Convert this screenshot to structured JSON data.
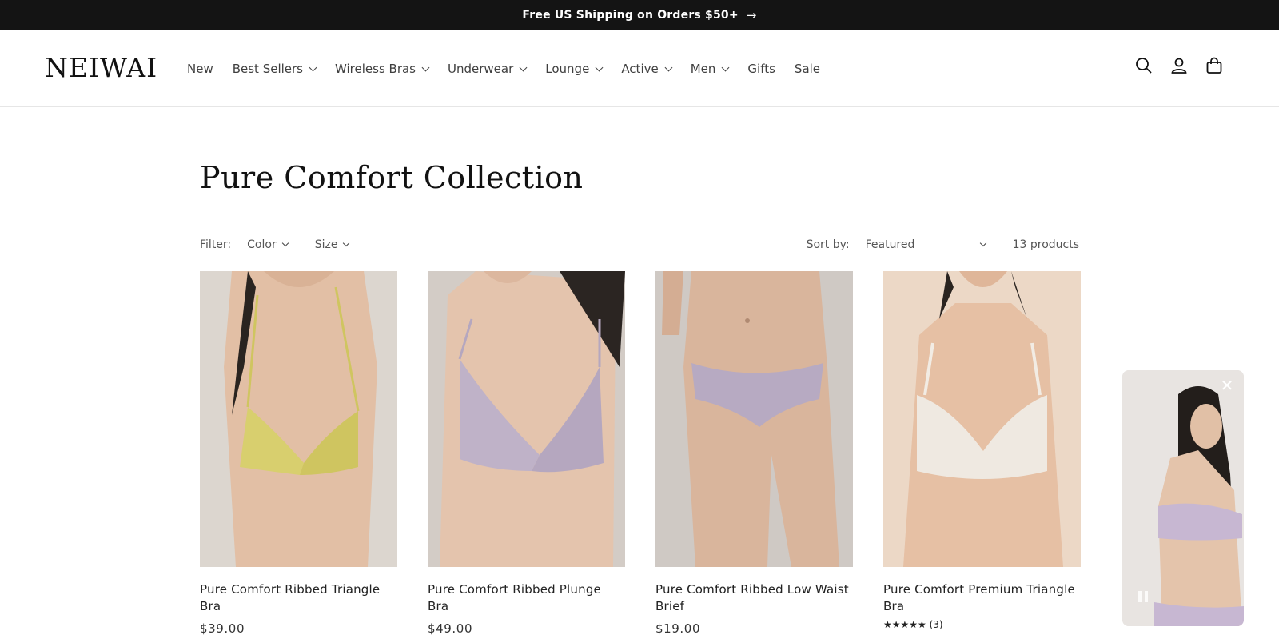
{
  "announcement": {
    "text": "Free US Shipping on Orders $50+",
    "arrow_icon": "arrow-right-icon"
  },
  "header": {
    "logo": "NEIWAI",
    "nav": [
      {
        "label": "New",
        "dropdown": false
      },
      {
        "label": "Best Sellers",
        "dropdown": true
      },
      {
        "label": "Wireless Bras",
        "dropdown": true
      },
      {
        "label": "Underwear",
        "dropdown": true
      },
      {
        "label": "Lounge",
        "dropdown": true
      },
      {
        "label": "Active",
        "dropdown": true
      },
      {
        "label": "Men",
        "dropdown": true
      },
      {
        "label": "Gifts",
        "dropdown": false
      },
      {
        "label": "Sale",
        "dropdown": false
      }
    ],
    "icons": [
      "search-icon",
      "account-icon",
      "cart-icon"
    ]
  },
  "collection": {
    "title": "Pure Comfort Collection",
    "filter_label": "Filter:",
    "filters": [
      "Color",
      "Size"
    ],
    "sort_label": "Sort by:",
    "sort_value": "Featured",
    "product_count": "13 products"
  },
  "products": [
    {
      "title": "Pure Comfort Ribbed Triangle Bra",
      "price": "$39.00",
      "rating": "",
      "garment_color": "#d8cf6e"
    },
    {
      "title": "Pure Comfort Ribbed Plunge Bra",
      "price": "$49.00",
      "rating": "",
      "garment_color": "#bfb2c8"
    },
    {
      "title": "Pure Comfort Ribbed Low Waist Brief",
      "price": "$19.00",
      "rating": "",
      "garment_color": "#b7aac2"
    },
    {
      "title": "Pure Comfort Premium Triangle Bra",
      "price": "",
      "rating": "★★★★★ (3)",
      "garment_color": "#efe9e1"
    }
  ],
  "video_popup": {
    "close_icon": "close-icon",
    "pause_icon": "pause-icon"
  },
  "colors": {
    "announcement_bg": "#141414",
    "text": "#121212",
    "nav_text": "#3f3f3f"
  }
}
